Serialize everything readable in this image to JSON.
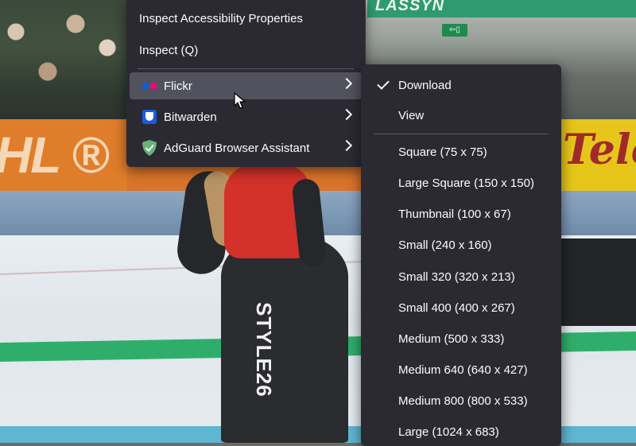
{
  "background": {
    "banner_text": "LASSYN",
    "exit_sign": "⇦▯",
    "board_left_text": "HL ®",
    "board_right_text": "Tele",
    "skater_text": "STYLE26"
  },
  "main_menu": {
    "items": [
      {
        "label": "Inspect Accessibility Properties"
      },
      {
        "label": "Inspect (Q)"
      },
      {
        "label": "Flickr",
        "icon": "flickr-icon",
        "has_submenu": true,
        "highlighted": true
      },
      {
        "label": "Bitwarden",
        "icon": "bitwarden-icon",
        "has_submenu": true
      },
      {
        "label": "AdGuard Browser Assistant",
        "icon": "adguard-icon",
        "has_submenu": true
      }
    ]
  },
  "submenu": {
    "items": [
      {
        "label": "Download",
        "checked": true
      },
      {
        "label": "View"
      },
      {
        "label": "Square (75 x 75)"
      },
      {
        "label": "Large Square (150 x 150)"
      },
      {
        "label": "Thumbnail (100 x 67)"
      },
      {
        "label": "Small (240 x 160)"
      },
      {
        "label": "Small 320 (320 x 213)"
      },
      {
        "label": "Small 400 (400 x 267)"
      },
      {
        "label": "Medium (500 x 333)"
      },
      {
        "label": "Medium 640 (640 x 427)"
      },
      {
        "label": "Medium 800 (800 x 533)"
      },
      {
        "label": "Large (1024 x 683)"
      }
    ]
  },
  "colors": {
    "menu_bg": "#2b2a33",
    "menu_hover": "#52525e",
    "menu_text": "#fbfbfe",
    "flickr_blue": "#0063dc",
    "flickr_pink": "#ff0084",
    "bitwarden_blue": "#175ddc",
    "adguard_green": "#67b279"
  }
}
